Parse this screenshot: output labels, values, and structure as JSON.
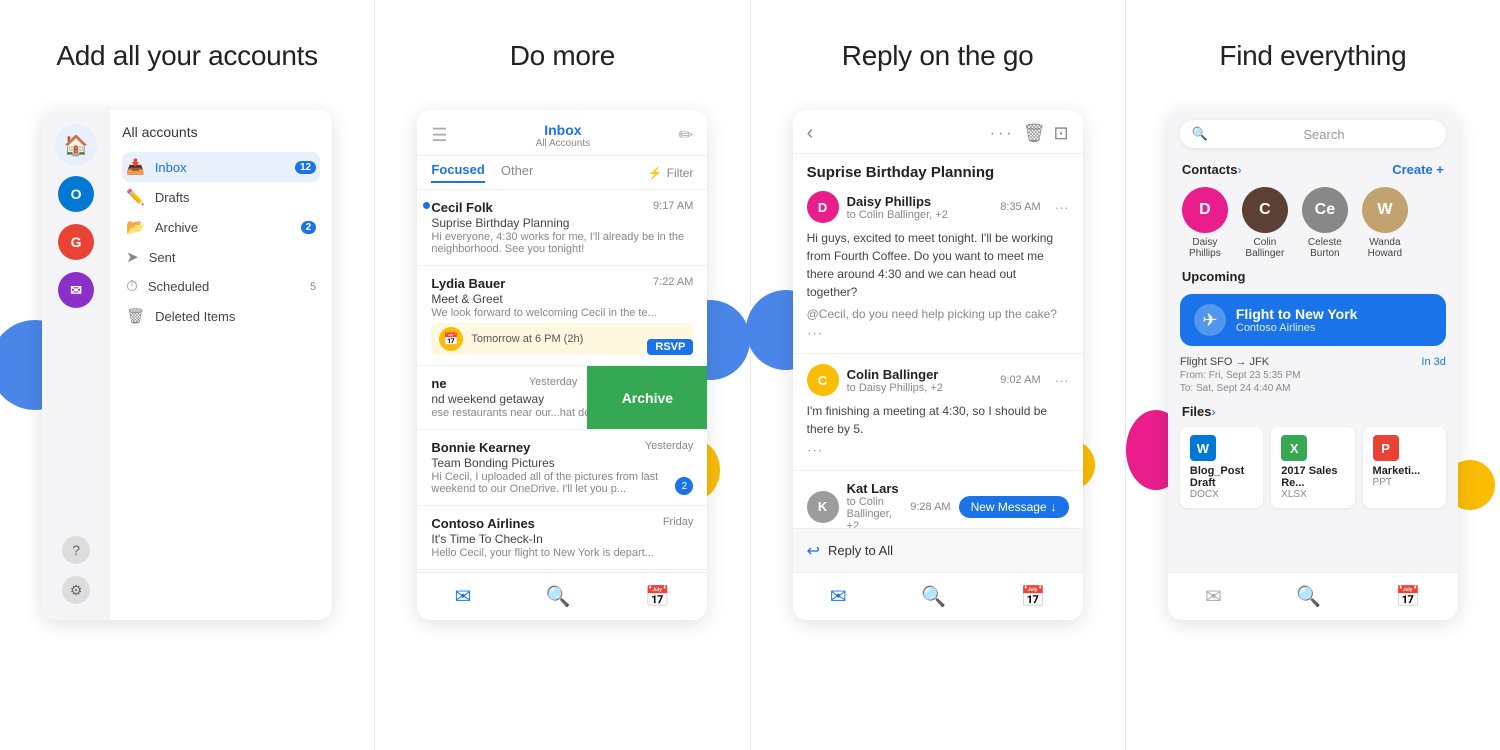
{
  "sections": [
    {
      "id": "add-accounts",
      "title": "Add all your accounts",
      "sidebar": {
        "all_accounts": "All accounts",
        "items": [
          {
            "label": "Inbox",
            "icon": "inbox",
            "badge": "12",
            "active": true
          },
          {
            "label": "Drafts",
            "icon": "drafts",
            "badge": "",
            "active": false
          },
          {
            "label": "Archive",
            "icon": "archive",
            "badge": "2",
            "active": false
          },
          {
            "label": "Sent",
            "icon": "sent",
            "badge": "",
            "active": false
          },
          {
            "label": "Scheduled",
            "icon": "scheduled",
            "badge": "5",
            "active": false
          },
          {
            "label": "Deleted Items",
            "icon": "trash",
            "badge": "",
            "active": false
          }
        ],
        "accounts": [
          {
            "color": "#0078d4",
            "letter": "O"
          },
          {
            "color": "#ea4335",
            "letter": "G"
          },
          {
            "color": "#8b2fc9",
            "letter": "M"
          }
        ]
      }
    },
    {
      "id": "do-more",
      "title": "Do more",
      "email_client": {
        "title": "Inbox",
        "subtitle": "All Accounts",
        "tabs": [
          "Focused",
          "Other"
        ],
        "active_tab": "Focused",
        "emails": [
          {
            "sender": "Cecil Folk",
            "subject": "Suprise Birthday Planning",
            "preview": "Hi everyone, 4:30 works for me, I'll already be in the neighborhood. See you tonight!",
            "time": "9:17 AM",
            "badge": ""
          },
          {
            "sender": "Lydia Bauer",
            "subject": "Meet & Greet",
            "preview": "We look forward to welcoming Cecil in the te...",
            "time": "7:22 AM",
            "event": "Tomorrow at 6 PM (2h)",
            "rsvp": "RSVP"
          },
          {
            "sender": "ne",
            "subject": "nd weekend getaway",
            "preview": "ese restaurants near our...hat do you think? I like th...",
            "time": "Yesterday",
            "archive": true
          },
          {
            "sender": "Bonnie Kearney",
            "subject": "Team Bonding Pictures",
            "preview": "Hi Cecil, I uploaded all of the pictures from last weekend to our OneDrive. I'll let you p...",
            "time": "Yesterday",
            "badge": "2"
          },
          {
            "sender": "Contoso Airlines",
            "subject": "It's Time To Check-In",
            "preview": "Hello Cecil, your flight to New York is depart...",
            "time": "Friday",
            "badge": ""
          }
        ]
      }
    },
    {
      "id": "reply-go",
      "title": "Reply on the go",
      "thread": {
        "subject": "Suprise Birthday Planning",
        "messages": [
          {
            "sender": "Daisy Phillips",
            "to": "to Colin Ballinger, +2",
            "time": "8:35 AM",
            "body": "Hi guys, excited to meet tonight. I'll be working from Fourth Coffee. Do you want to meet me there around 4:30 and we can head out together?",
            "avatar_color": "#e91e8c",
            "avatar_letter": "D"
          },
          {
            "sender": "Colin Ballinger",
            "to": "to Daisy Phillips, +2",
            "time": "9:02 AM",
            "body": "I'm finishing a meeting at 4:30, so I should be there by 5.",
            "avatar_color": "#fbbc04",
            "avatar_letter": "C"
          },
          {
            "sender": "Kat Lars",
            "to": "to Colin Ballinger, +2",
            "time": "9:28 AM",
            "body": "",
            "new_message": true,
            "avatar_color": "#4a86e8",
            "avatar_letter": "K"
          }
        ],
        "reply_label": "Reply to All"
      }
    },
    {
      "id": "find-everything",
      "title": "Find everything",
      "search": {
        "placeholder": "Search"
      },
      "contacts": {
        "label": "Contacts",
        "create_label": "Create +",
        "items": [
          {
            "name": "Daisy Phillips",
            "color": "#e91e8c",
            "letter": "D"
          },
          {
            "name": "Colin Ballinger",
            "color": "#fbbc04",
            "letter": "C"
          },
          {
            "name": "Celeste Burton",
            "color": "#888",
            "letter": "Ce"
          },
          {
            "name": "Wanda Howard",
            "color": "#4a86e8",
            "letter": "W"
          }
        ]
      },
      "upcoming": {
        "label": "Upcoming",
        "flight": {
          "title": "Flight to New York",
          "airline": "Contoso Airlines",
          "route": "Flight SFO → JFK",
          "in_days": "In 3d",
          "from": "From: Fri, Sept 23 5:35 PM",
          "to": "To: Sat, Sept 24 4:40 AM"
        }
      },
      "files": {
        "label": "Files",
        "items": [
          {
            "name": "Blog_Post Draft",
            "type": "DOCX",
            "color": "#0078d4",
            "letter": "W"
          },
          {
            "name": "2017 Sales Re...",
            "type": "XLSX",
            "color": "#34a853",
            "letter": "X"
          },
          {
            "name": "Marketi...",
            "type": "PPT",
            "color": "#ea4335",
            "letter": "P"
          }
        ]
      }
    }
  ]
}
